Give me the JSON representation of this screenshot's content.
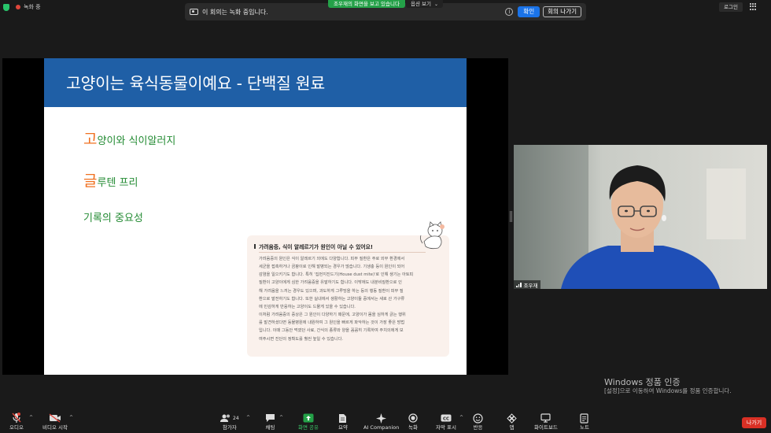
{
  "topbar": {
    "recording_status": "녹화 중",
    "share_banner": "조우재의 화면을 보고 있습니다",
    "view_options": "옵션 보기",
    "recording_notice": "이 회의는 녹화 중입니다.",
    "confirm_button": "확인",
    "leave_meeting_button": "회의 나가기",
    "login_button": "로그인"
  },
  "slide": {
    "title": "고양이는 육식동물이예요 - 단백질 원료",
    "bullets": [
      {
        "first": "고",
        "rest": "양이와 식이알러지"
      },
      {
        "first": "글",
        "rest": "루텐 프리"
      },
      {
        "first": "",
        "rest": "기록의 중요성"
      }
    ],
    "card": {
      "title": "가려움증, 식이 알레르기가 원인이 아닐 수 있어요!",
      "lines": [
        "가려움증의 원인은 식이 알레르기 외에도 다양합니다. 피부 질환은 주로 외부 환경에서",
        "세균을 접촉하거나 곰팡이로 인해 발병되는 경우가 많습니다. 기생충 등이 원인이 되어",
        "감염을 일으키기도 합니다. 특히 '집먼지진드기(House dust mite)'로 인해 생기는 아토피",
        "질환이 고양이에게 심한 가려움증을 유발하기도 합니다. 이밖에도 내분비질환으로 인",
        "해 가려움을 느끼는 경우도 있으며, 과도하게 그루밍을 하는 등의 행동 질환이 피부 질",
        "환으로 발전하기도 합니다. 또한 실내에서 생활하는 고양이들 중에서는 새로 산 가구류",
        "에 민감하게 반응하는 고양이도 드물게 있을 수 있습니다.",
        "이처럼 가려움증의 증상은 그 원인이 다양하기 때문에, 고양이가 몸을 심하게 긁는 행위",
        "를 발견하셨다면 동물병원에 내원하여 그 원인을 빠르게 파악하는 것이 가장 좋은 방법",
        "입니다. 이때 그동안 먹였던 사료, 간식의 종류와 양을 꼼꼼히 기록하여 주치의에게 보",
        "여주시면 진단의 정확도를 훨씬 높일 수 있습니다."
      ]
    }
  },
  "video": {
    "participant_name": "조우재"
  },
  "watermark": {
    "title": "Windows 정품 인증",
    "subtitle": "[설정]으로 이동하여 Windows를 정품 인증합니다."
  },
  "toolbar": {
    "audio": "오디오",
    "video": "비디오 시작",
    "participants": "참가자",
    "participants_count": "24",
    "chat": "채팅",
    "share_screen": "화면 공유",
    "summary": "요약",
    "ai_companion": "AI Companion",
    "record": "녹화",
    "captions": "자막 표시",
    "reactions": "반응",
    "apps": "앱",
    "whiteboard": "화이트보드",
    "notes": "노트",
    "leave": "나가기"
  },
  "colors": {
    "slide_header": "#1f5fa6",
    "bullet_first_letter": "#f07020",
    "bullet_text": "#238b33",
    "card_bg": "#faf1ec",
    "share_banner": "#24a148",
    "confirm_button": "#1a73e8",
    "leave_button": "#d93025"
  }
}
